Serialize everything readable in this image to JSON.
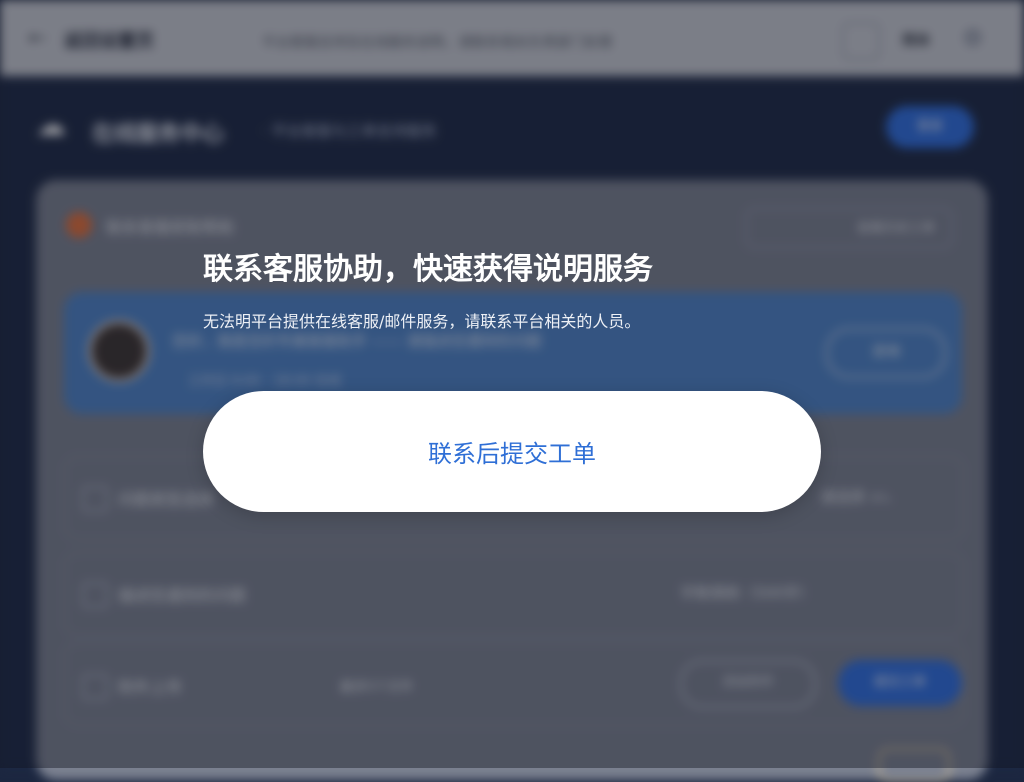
{
  "topbar": {
    "back_icon": "back-arrow-icon",
    "title": "返回设置页",
    "center_text": "平台客服支持及在线服务说明，请联系相关负责部门处理",
    "language": "简体",
    "settings_icon": "gear-icon"
  },
  "header": {
    "logo_icon": "cloud-logo-icon",
    "brand": "在线服务中心",
    "subtitle": "· 平台客服与工单支持服务",
    "action_label": "登录"
  },
  "card": {
    "title": "联系客服获取帮助",
    "action_label": "查看历史工单"
  },
  "banner": {
    "line1": "您好，我是您的专属客服助手 —— 请描述您遇到的问题",
    "line2": "工作日 9:00 - 18:00 在线",
    "button_label": "咨询"
  },
  "rows": [
    {
      "label": "问题类型选择",
      "right": "请选择 ∧∟"
    },
    {
      "label": "描述您遇到的问题",
      "right": "字数限制（500字）"
    },
    {
      "label": "附件上传",
      "note": "最多5个文件",
      "btn_outline": "添加附件",
      "btn_primary": "提交工单"
    }
  ],
  "popup": {
    "title": "联系客服协助，快速获得说明服务",
    "subtitle": "无法明平台提供在线客服/邮件服务，请联系平台相关的人员。",
    "button_label": "联系后提交工单"
  },
  "colors": {
    "accent": "#2f6fd6",
    "navy": "#1d2945",
    "banner": "#4e84c8"
  }
}
